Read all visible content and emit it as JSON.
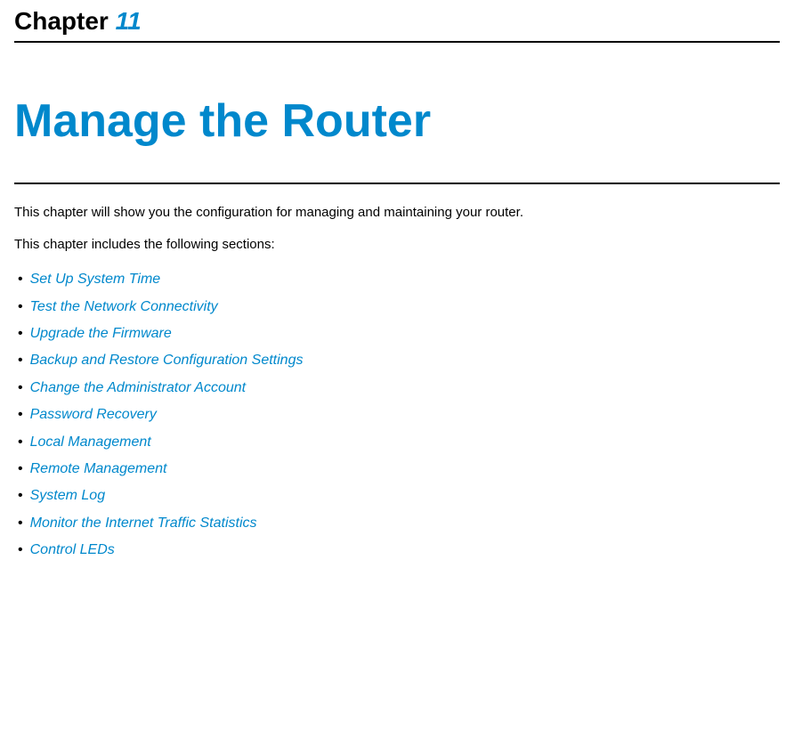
{
  "header": {
    "chapter_label": "Chapter",
    "chapter_number": "11"
  },
  "title": "Manage the Router",
  "intro": {
    "line1": "This chapter will show you the configuration for managing and maintaining your router.",
    "line2": "This chapter includes the following sections:"
  },
  "sections": [
    "Set Up System Time",
    "Test the Network Connectivity",
    "Upgrade the Firmware",
    "Backup and Restore Configuration Settings",
    "Change the Administrator Account",
    "Password Recovery",
    "Local Management",
    "Remote Management",
    "System Log",
    "Monitor the Internet Traffic Statistics",
    "Control LEDs"
  ]
}
